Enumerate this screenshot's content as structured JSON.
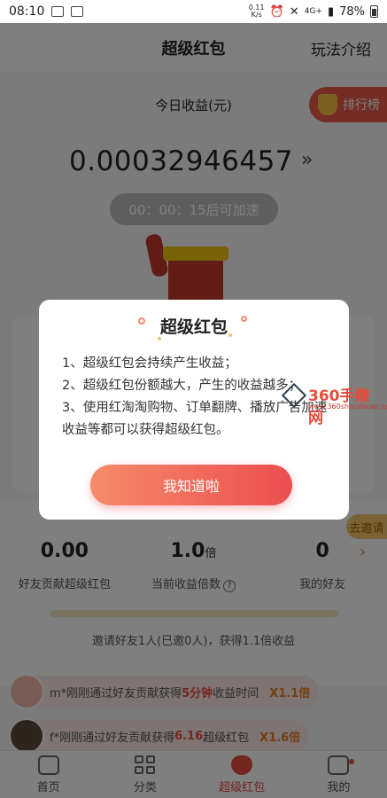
{
  "status_bar": {
    "time": "08:10",
    "speed_value": "0.11",
    "speed_unit": "K/s",
    "network": "4G+",
    "battery": "78%"
  },
  "header": {
    "title": "超级红包",
    "rules_link": "玩法介绍"
  },
  "earnings": {
    "label": "今日收益(元)",
    "amount": "0.00032946457",
    "arrow": "»",
    "timer": "00：00：15后可加速",
    "rank_button": "排行榜"
  },
  "invite": {
    "tag": "去邀请",
    "stats": [
      {
        "value": "0.00",
        "unit": "",
        "label": "好友贡献超级红包"
      },
      {
        "value": "1.0",
        "unit": "倍",
        "label": "当前收益倍数"
      },
      {
        "value": "0",
        "unit": "",
        "label": "我的好友"
      }
    ],
    "help_icon": "?",
    "chevron": "›",
    "progress": 0.0,
    "note": "邀请好友1人(已邀0人)，获得1.1倍收益"
  },
  "feed": [
    {
      "prefix": "m*刚刚通过好友贡献获得",
      "highlight": "5分钟",
      "suffix": "收益时间",
      "multiplier": "X1.1倍"
    },
    {
      "prefix": "f*刚刚通过好友贡献获得",
      "highlight": "6.16",
      "suffix": "超级红包",
      "multiplier": "X1.6倍"
    }
  ],
  "tabs": [
    {
      "label": "首页",
      "icon": "home-icon"
    },
    {
      "label": "分类",
      "icon": "category-icon"
    },
    {
      "label": "超级红包",
      "icon": "red-packet-icon",
      "active": true
    },
    {
      "label": "我的",
      "icon": "profile-icon"
    }
  ],
  "modal": {
    "title": "超级红包",
    "lines": [
      "1、超级红包会持续产生收益；",
      "2、超级红包份额越大，产生的收益越多；",
      "3、使用红淘淘购物、订单翻牌、播放广告加速收益等都可以获得超级红包。"
    ],
    "confirm_button": "我知道啦"
  },
  "watermark": {
    "text": "360手赚网",
    "sub": "www.360shouzhuan.com"
  },
  "colors": {
    "accent": "#ec4e4e",
    "gold": "#e8c77f",
    "highlight": "#e74c3c"
  }
}
